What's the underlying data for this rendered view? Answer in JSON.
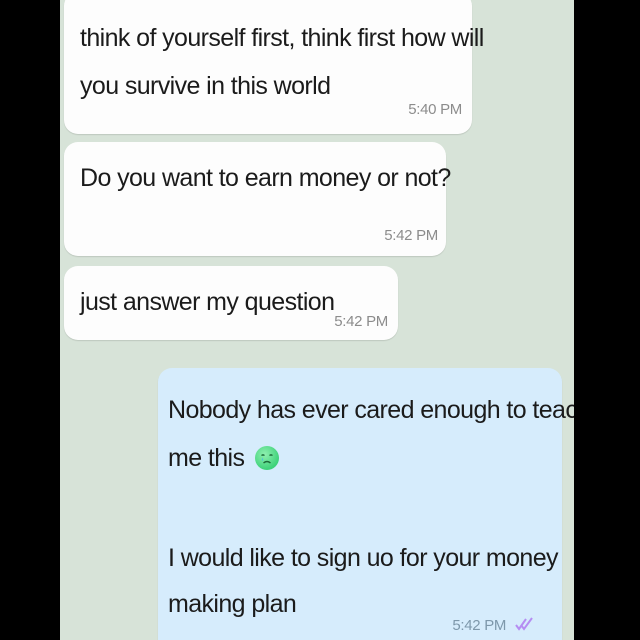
{
  "messages": [
    {
      "direction": "incoming",
      "lines": [
        "think of yourself first, think first how will",
        "you survive in this world"
      ],
      "time": "5:40 PM"
    },
    {
      "direction": "incoming",
      "lines": [
        "Do you want to earn money or not?"
      ],
      "time": "5:42 PM"
    },
    {
      "direction": "incoming",
      "lines": [
        "just answer my question"
      ],
      "time": "5:42 PM"
    },
    {
      "direction": "outgoing",
      "lines": [
        "Nobody has ever cared enough to teach",
        "me this",
        "I would like to sign uo for your money",
        "making plan"
      ],
      "emoji": "crying-face-emoji",
      "status_icon": "double-check-read-icon",
      "time": "5:42 PM"
    }
  ],
  "colors": {
    "chat_background": "#d7e3d8",
    "incoming_bubble": "#fdfdfd",
    "outgoing_bubble": "#d6ecfc",
    "read_ticks": "#b58df2",
    "letterbox": "#000000"
  }
}
